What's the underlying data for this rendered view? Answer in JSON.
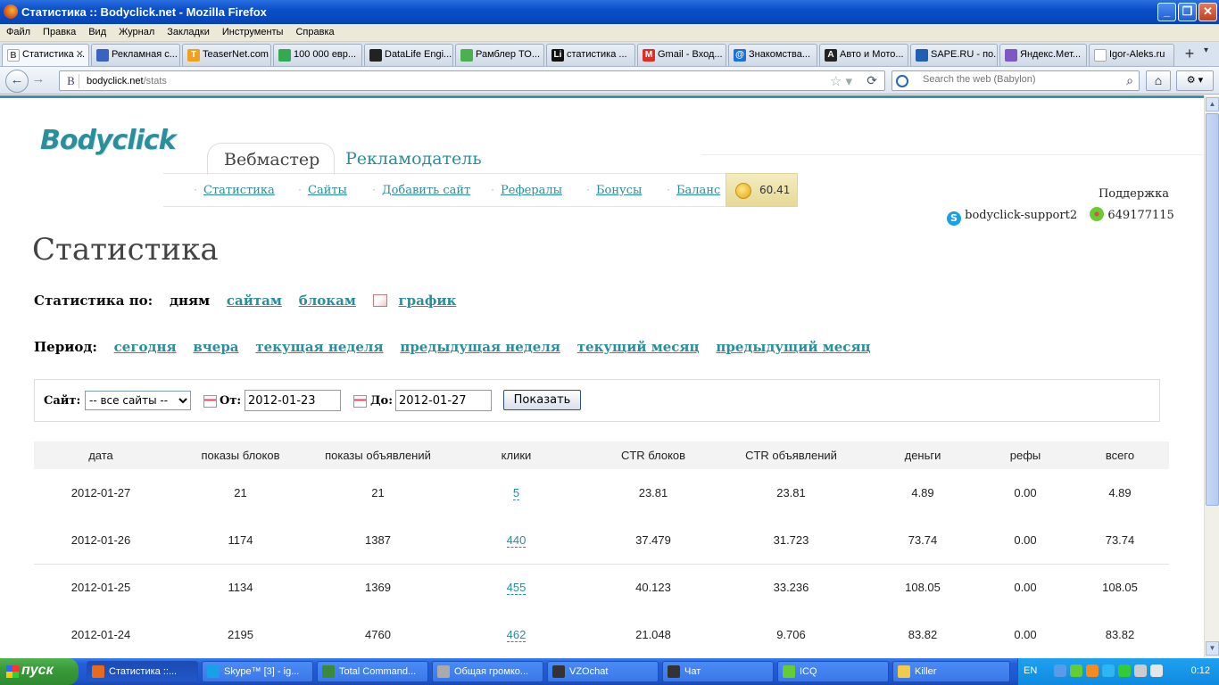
{
  "window": {
    "title": "Статистика :: Bodyclick.net - Mozilla Firefox"
  },
  "menu": [
    "Файл",
    "Правка",
    "Вид",
    "Журнал",
    "Закладки",
    "Инструменты",
    "Справка"
  ],
  "tabs": [
    {
      "label": "Статистика ...",
      "color": "#ffffff",
      "active": true
    },
    {
      "label": "Рекламная с...",
      "color": "#3a63c0"
    },
    {
      "label": "TeaserNet.com",
      "color": "#f0a020"
    },
    {
      "label": "100 000 евр...",
      "color": "#34a853"
    },
    {
      "label": "DataLife Engi...",
      "color": "#222222"
    },
    {
      "label": "Рамблер ТО...",
      "color": "#4caf50"
    },
    {
      "label": "статистика ...",
      "color": "#111111"
    },
    {
      "label": "Gmail - Вход...",
      "color": "#d93025"
    },
    {
      "label": "Знакомства...",
      "color": "#1e6fd9"
    },
    {
      "label": "Авто и Мото...",
      "color": "#222222"
    },
    {
      "label": "SAPE.RU - по...",
      "color": "#1d5fb3"
    },
    {
      "label": "Яндекс.Мет...",
      "color": "#7e57c2"
    },
    {
      "label": "Igor-Aleks.ru",
      "color": "#ffffff"
    }
  ],
  "nav": {
    "url_host": "bodyclick.net",
    "url_path": "/stats",
    "search_placeholder": "Search the web (Babylon)"
  },
  "site": {
    "logo": "Bodyclick",
    "role_active": "Вебмастер",
    "role_other": "Рекламодатель",
    "subnav": [
      "Статистика",
      "Сайты",
      "Добавить сайт",
      "Рефералы",
      "Бонусы",
      "Баланс"
    ],
    "balance": "60.41",
    "support_label": "Поддержка",
    "skype": "bodyclick-support2",
    "icq": "649177115"
  },
  "page": {
    "title": "Статистика",
    "stat_by_label": "Статистика по:",
    "stat_by_current": "дням",
    "stat_by_links": [
      "сайтам",
      "блокам",
      "график"
    ],
    "period_label": "Период:",
    "period_links": [
      "сегодня",
      "вчера",
      "текущая неделя",
      "предыдущая неделя",
      "текущий месяц",
      "предыдущий месяц"
    ]
  },
  "filter": {
    "site_label": "Сайт:",
    "site_value": "-- все сайты --",
    "from_label": "От:",
    "from_value": "2012-01-23",
    "to_label": "До:",
    "to_value": "2012-01-27",
    "show_button": "Показать"
  },
  "table": {
    "headers": [
      "дата",
      "показы блоков",
      "показы объявлений",
      "клики",
      "CTR блоков",
      "CTR объявлений",
      "деньги",
      "рефы",
      "всего"
    ],
    "rows": [
      [
        "2012-01-27",
        "21",
        "21",
        "5",
        "23.81",
        "23.81",
        "4.89",
        "0.00",
        "4.89"
      ],
      [
        "2012-01-26",
        "1174",
        "1387",
        "440",
        "37.479",
        "31.723",
        "73.74",
        "0.00",
        "73.74"
      ],
      [
        "2012-01-25",
        "1134",
        "1369",
        "455",
        "40.123",
        "33.236",
        "108.05",
        "0.00",
        "108.05"
      ],
      [
        "2012-01-24",
        "2195",
        "4760",
        "462",
        "21.048",
        "9.706",
        "83.82",
        "0.00",
        "83.82"
      ]
    ]
  },
  "taskbar": {
    "start": "пуск",
    "tasks": [
      {
        "label": "Статистика ::...",
        "color": "#e86a1c",
        "active": true
      },
      {
        "label": "Skype™ [3] - ig...",
        "color": "#19a0e6"
      },
      {
        "label": "Total Command...",
        "color": "#3a8a3a"
      },
      {
        "label": "Общая громко...",
        "color": "#aaaaaa"
      },
      {
        "label": "VZOchat",
        "color": "#333333"
      },
      {
        "label": "Чат",
        "color": "#333333"
      },
      {
        "label": "ICQ",
        "color": "#6c3"
      },
      {
        "label": "Killer",
        "color": "#f2c94c"
      }
    ],
    "lang": "EN",
    "clock": "0:12"
  }
}
